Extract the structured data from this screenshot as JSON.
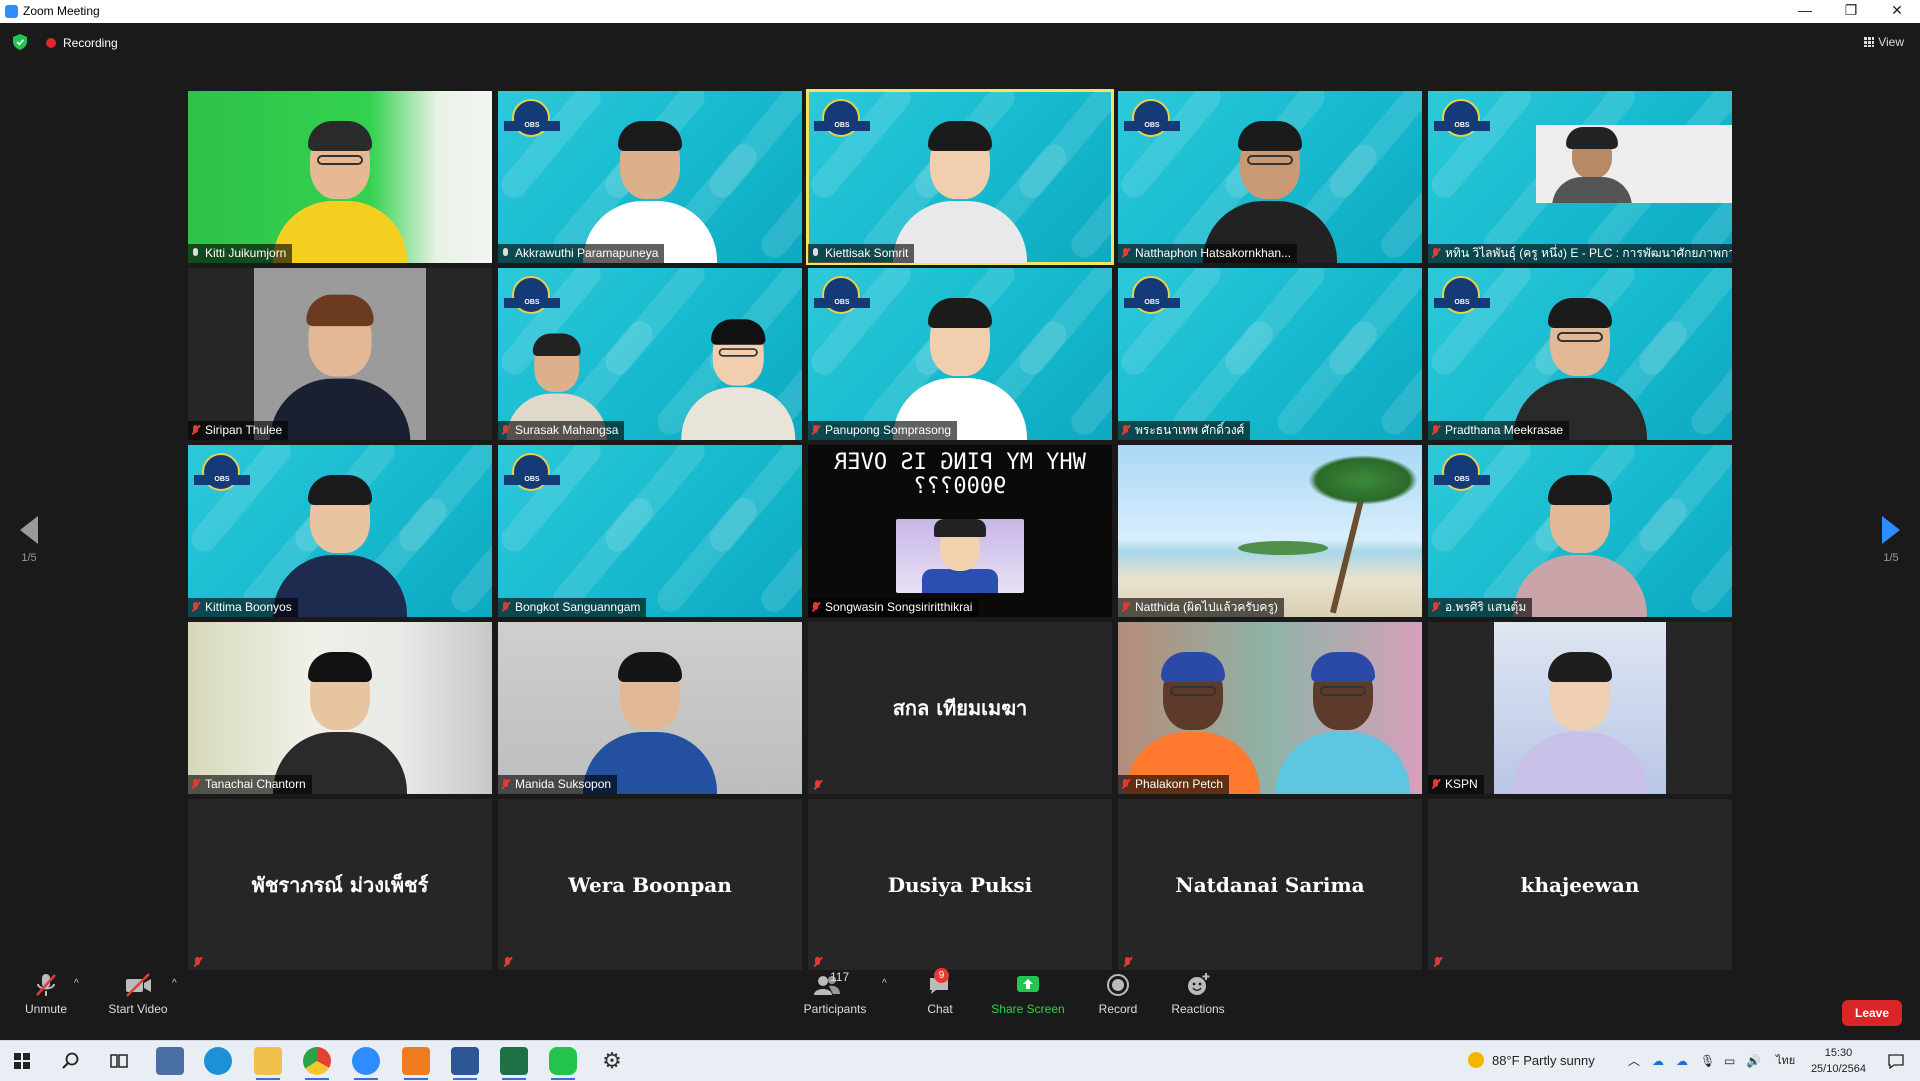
{
  "window": {
    "title": "Zoom Meeting",
    "minimize": "—",
    "maximize": "❐",
    "close": "✕"
  },
  "infobar": {
    "recording": "Recording",
    "view": "View"
  },
  "pager": {
    "left": "1/5",
    "right": "1/5"
  },
  "tiles": [
    {
      "name": "Kitti Juikumjorn",
      "muted": false,
      "style": "video-green"
    },
    {
      "name": "Akkrawuthi Paramapuneya",
      "muted": false,
      "style": "video-cyan"
    },
    {
      "name": "Kiettisak Somrit",
      "muted": false,
      "style": "video-cyan",
      "active": true
    },
    {
      "name": "Natthaphon Hatsakornkhan...",
      "muted": true,
      "style": "video-cyan"
    },
    {
      "name": "หทิน วิไลพันธุ์ (ครู หนึ่ง) E - PLC : การพัฒนาศักยภาพการสอนออนไลน์ (I",
      "muted": true,
      "style": "video-cyan-inset"
    },
    {
      "name": "Siripan Thulee",
      "muted": true,
      "style": "photo-grey"
    },
    {
      "name": "Surasak Mahangsa",
      "muted": true,
      "style": "video-cyan-two"
    },
    {
      "name": "Panupong Somprasong",
      "muted": true,
      "style": "video-cyan"
    },
    {
      "name": "พระธนาเทพ ศักดิ์วงศ์",
      "muted": true,
      "style": "video-cyan-empty"
    },
    {
      "name": "Pradthana Meekrasae",
      "muted": true,
      "style": "video-cyan"
    },
    {
      "name": "Kittima Boonyos",
      "muted": true,
      "style": "video-cyan"
    },
    {
      "name": "Bongkot Sanguanngam",
      "muted": true,
      "style": "video-cyan-empty"
    },
    {
      "name": "Songwasin Songsiriritthikrai",
      "muted": true,
      "style": "meme",
      "meme_text": "WHY MY PING IS OVER 9000???"
    },
    {
      "name": "Natthida (ผิดไปแล้วครับครู)",
      "muted": true,
      "style": "beach"
    },
    {
      "name": "อ.พรศิริ  แสนตุ้ม",
      "muted": true,
      "style": "video-cyan"
    },
    {
      "name": "Tanachai Chantorn",
      "muted": true,
      "style": "video-room"
    },
    {
      "name": "Manida Suksopon",
      "muted": true,
      "style": "video-room-grey"
    },
    {
      "name": "",
      "muted": true,
      "style": "name-only",
      "display": "สกล เทียมเมฆา"
    },
    {
      "name": "Phalakorn Petch",
      "muted": true,
      "style": "video-room-colorful"
    },
    {
      "name": "KSPN",
      "muted": true,
      "style": "photo-portrait"
    },
    {
      "name": "",
      "muted": true,
      "style": "name-only",
      "display": "พัชราภรณ์ ม่วงเพ็ชร์"
    },
    {
      "name": "",
      "muted": true,
      "style": "name-only",
      "display": "Wera Boonpan"
    },
    {
      "name": "",
      "muted": true,
      "style": "name-only",
      "display": "Dusiya Puksi"
    },
    {
      "name": "",
      "muted": true,
      "style": "name-only",
      "display": "Natdanai Sarima"
    },
    {
      "name": "",
      "muted": true,
      "style": "name-only",
      "display": "khajeewan"
    }
  ],
  "toolbar": {
    "unmute": "Unmute",
    "start_video": "Start Video",
    "participants": "Participants",
    "participants_count": "117",
    "chat": "Chat",
    "chat_badge": "9",
    "share_screen": "Share Screen",
    "record": "Record",
    "reactions": "Reactions",
    "leave": "Leave"
  },
  "taskbar": {
    "weather": "88°F  Partly sunny",
    "language": "ไทย",
    "time": "15:30",
    "date": "25/10/2564"
  },
  "colors": {
    "accent": "#2d8cff",
    "leave": "#d92525",
    "share": "#2dd34a",
    "active_speaker": "#f2e45c",
    "tile_bg": "#262626"
  }
}
